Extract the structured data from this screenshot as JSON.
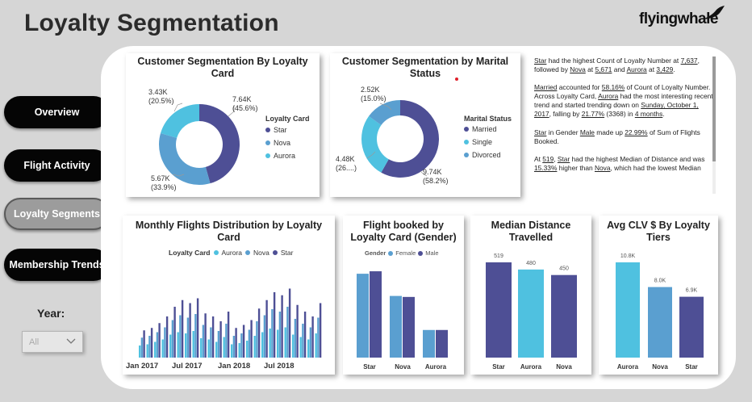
{
  "page": {
    "title": "Loyalty Segmentation"
  },
  "logo": {
    "text_a": "flying",
    "text_b": "whale"
  },
  "nav": [
    {
      "label": "Overview",
      "active": false
    },
    {
      "label": "Flight Activity",
      "active": false
    },
    {
      "label": "Loyalty Segments",
      "active": true
    },
    {
      "label": "Membership Trends",
      "active": false
    }
  ],
  "filter": {
    "label": "Year:",
    "value": "All"
  },
  "colors": {
    "star": "#4e4f95",
    "nova": "#5a9fd0",
    "aurora": "#4fc1e0"
  },
  "chart_data": [
    {
      "type": "pie",
      "title": "Customer Segmentation By Loyalty Card",
      "legend_title": "Loyalty Card",
      "labels": [
        "Star",
        "Nova",
        "Aurora"
      ],
      "values": [
        7637,
        5671,
        3429
      ],
      "data_labels": [
        {
          "value": "7.64K",
          "pct": "(45.6%)"
        },
        {
          "value": "5.67K",
          "pct": "(33.9%)"
        },
        {
          "value": "3.43K",
          "pct": "(20.5%)"
        }
      ]
    },
    {
      "type": "pie",
      "title": "Customer Segmentation by Marital Status",
      "legend_title": "Marital Status",
      "labels": [
        "Married",
        "Single",
        "Divorced"
      ],
      "values": [
        9740,
        4480,
        2520
      ],
      "data_labels": [
        {
          "value": "9.74K",
          "pct": "(58.2%)"
        },
        {
          "value": "4.48K",
          "pct": "(26....)"
        },
        {
          "value": "2.52K",
          "pct": "(15.0%)"
        }
      ]
    },
    {
      "type": "bar",
      "title": "Monthly Flights Distribution by Loyalty Card",
      "legend_title": "Loyalty Card",
      "legend_order": [
        "Aurora",
        "Nova",
        "Star"
      ],
      "x_ticks": [
        "Jan 2017",
        "Jul 2017",
        "Jan 2018",
        "Jul 2018"
      ],
      "categories": [
        "Jan 2017",
        "Feb 2017",
        "Mar 2017",
        "Apr 2017",
        "May 2017",
        "Jun 2017",
        "Jul 2017",
        "Aug 2017",
        "Sep 2017",
        "Oct 2017",
        "Nov 2017",
        "Dec 2017",
        "Jan 2018",
        "Feb 2018",
        "Mar 2018",
        "Apr 2018",
        "May 2018",
        "Jun 2018",
        "Jul 2018",
        "Aug 2018",
        "Sep 2018",
        "Oct 2018",
        "Nov 2018",
        "Dec 2018"
      ],
      "series": [
        {
          "name": "Aurora",
          "values": [
            20,
            22,
            26,
            30,
            38,
            42,
            40,
            44,
            32,
            30,
            26,
            34,
            22,
            24,
            28,
            36,
            42,
            48,
            46,
            50,
            38,
            34,
            30,
            40
          ]
        },
        {
          "name": "Nova",
          "values": [
            33,
            36,
            42,
            50,
            62,
            70,
            66,
            72,
            54,
            50,
            44,
            56,
            36,
            40,
            46,
            60,
            70,
            80,
            76,
            84,
            64,
            56,
            50,
            66
          ]
        },
        {
          "name": "Star",
          "values": [
            45,
            49,
            57,
            68,
            84,
            95,
            90,
            98,
            73,
            68,
            60,
            76,
            49,
            54,
            62,
            81,
            95,
            108,
            103,
            114,
            87,
            76,
            68,
            90
          ]
        }
      ]
    },
    {
      "type": "bar",
      "title": "Flight booked by Loyalty Card (Gender)",
      "legend_title": "Gender",
      "categories": [
        "Star",
        "Nova",
        "Aurora"
      ],
      "series": [
        {
          "name": "Female",
          "values": [
            34000,
            25000,
            11200
          ]
        },
        {
          "name": "Male",
          "values": [
            35000,
            24600,
            11200
          ]
        }
      ]
    },
    {
      "type": "bar",
      "title": "Median Distance Travelled",
      "categories": [
        "Star",
        "Aurora",
        "Nova"
      ],
      "values": [
        519,
        480,
        450
      ],
      "data_labels": [
        "519",
        "480",
        "450"
      ]
    },
    {
      "type": "bar",
      "title": "Avg CLV $ By Loyalty Tiers",
      "categories": [
        "Aurora",
        "Nova",
        "Star"
      ],
      "values": [
        10800,
        8000,
        6900
      ],
      "data_labels": [
        "10.8K",
        "8.0K",
        "6.9K"
      ]
    }
  ],
  "narrative": {
    "p1": {
      "a": "Star",
      "b": " had the highest Count of Loyalty Number at ",
      "c": "7,637",
      "d": ", followed by ",
      "e": "Nova",
      "f": " at ",
      "g": "5,671",
      "h": " and ",
      "i": "Aurora",
      "j": " at ",
      "k": "3,429",
      "l": "."
    },
    "p2": {
      "a": "Married",
      "b": " accounted for ",
      "c": "58.16%",
      "d": " of Count of Loyalty Number."
    },
    "p3": {
      "a": "Across Loyalty Card, ",
      "b": "Aurora",
      "c": " had the most interesting recent trend and started trending down on ",
      "d": "Sunday, October 1, 2017",
      "e": ", falling by ",
      "f": "21.77%",
      "g": " (3368) in ",
      "h": "4 months",
      "i": "."
    },
    "p4": {
      "a": "Star",
      "b": " in Gender ",
      "c": "Male",
      "d": " made up ",
      "e": "22.99%",
      "f": " of Sum of Flights Booked."
    },
    "p5": {
      "a": "At ",
      "b": "519",
      "c": ", ",
      "d": "Star",
      "e": " had the highest Median of Distance and was ",
      "f": "15.33%",
      "g": " higher than ",
      "h": "Nova",
      "i": ", which had the lowest Median"
    }
  }
}
